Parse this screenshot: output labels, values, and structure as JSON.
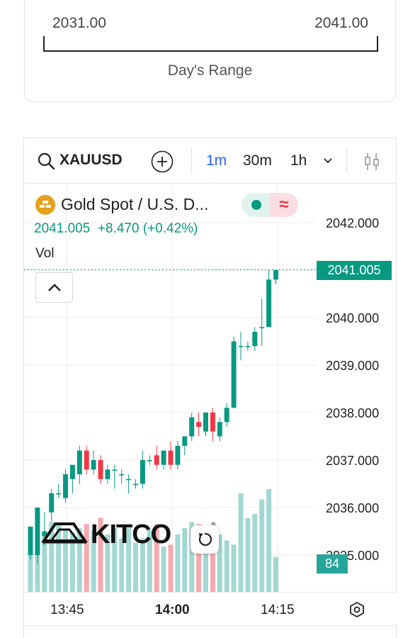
{
  "range": {
    "low": "2031.00",
    "high": "2041.00",
    "label": "Day's Range"
  },
  "toolbar": {
    "symbol": "XAUUSD",
    "intervals": [
      "1m",
      "30m",
      "1h"
    ],
    "active_interval": "1m",
    "icons": [
      "search-icon",
      "add-icon",
      "chevron-down-icon",
      "indicators-icon"
    ]
  },
  "legend": {
    "title": "Gold Spot / U.S. D...",
    "price": "2041.005",
    "change": "+8.470 (+0.42%)",
    "vol_label": "Vol"
  },
  "price_tag": "2041.005",
  "volume_tag": "84",
  "watermark": "KITCO",
  "colors": {
    "up": "#089981",
    "down": "#f23645",
    "vol_up": "#a3d8d2",
    "vol_down": "#f6a9ad",
    "accent": "#2962ff"
  },
  "chart_data": {
    "type": "candlestick",
    "y_ticks": [
      "2042.000",
      "2041.000",
      "2040.000",
      "2039.000",
      "2038.000",
      "2037.000",
      "2036.000",
      "2035.000"
    ],
    "ylim": [
      2034.2,
      2043.5
    ],
    "x_ticks": [
      "13:45",
      "14:00",
      "14:15"
    ],
    "x_ticks_bold": [
      false,
      true,
      false
    ],
    "current_price": 2041.005,
    "candles": [
      {
        "o": 2035.0,
        "h": 2035.3,
        "l": 2034.9,
        "c": 2035.6,
        "v": 58
      },
      {
        "o": 2035.0,
        "h": 2036.0,
        "l": 2034.8,
        "c": 2036.0,
        "v": 76
      },
      {
        "o": 2035.4,
        "h": 2035.9,
        "l": 2035.2,
        "c": 2035.5,
        "v": 58
      },
      {
        "o": 2035.9,
        "h": 2036.4,
        "l": 2035.7,
        "c": 2036.3,
        "v": 68
      },
      {
        "o": 2036.3,
        "h": 2036.5,
        "l": 2036.2,
        "c": 2036.3,
        "v": 66
      },
      {
        "o": 2036.2,
        "h": 2036.8,
        "l": 2036.1,
        "c": 2036.7,
        "v": 60
      },
      {
        "o": 2036.6,
        "h": 2036.9,
        "l": 2036.3,
        "c": 2036.9,
        "v": 58
      },
      {
        "o": 2036.7,
        "h": 2037.3,
        "l": 2036.5,
        "c": 2037.2,
        "v": 62
      },
      {
        "o": 2037.2,
        "h": 2037.3,
        "l": 2036.7,
        "c": 2036.8,
        "v": 66
      },
      {
        "o": 2036.8,
        "h": 2037.2,
        "l": 2036.7,
        "c": 2037.0,
        "v": 60
      },
      {
        "o": 2037.0,
        "h": 2037.1,
        "l": 2036.5,
        "c": 2036.6,
        "v": 72
      },
      {
        "o": 2036.6,
        "h": 2036.9,
        "l": 2036.5,
        "c": 2036.8,
        "v": 56
      },
      {
        "o": 2036.8,
        "h": 2036.9,
        "l": 2036.4,
        "c": 2036.8,
        "v": 62
      },
      {
        "o": 2036.7,
        "h": 2036.8,
        "l": 2036.5,
        "c": 2036.7,
        "v": 52
      },
      {
        "o": 2036.6,
        "h": 2036.7,
        "l": 2036.3,
        "c": 2036.6,
        "v": 62
      },
      {
        "o": 2036.5,
        "h": 2036.6,
        "l": 2036.4,
        "c": 2036.5,
        "v": 48
      },
      {
        "o": 2036.5,
        "h": 2037.2,
        "l": 2036.4,
        "c": 2037.0,
        "v": 52
      },
      {
        "o": 2037.0,
        "h": 2037.1,
        "l": 2036.9,
        "c": 2037.0,
        "v": 60
      },
      {
        "o": 2037.1,
        "h": 2037.3,
        "l": 2036.8,
        "c": 2036.9,
        "v": 66
      },
      {
        "o": 2036.9,
        "h": 2037.2,
        "l": 2036.8,
        "c": 2037.2,
        "v": 44
      },
      {
        "o": 2037.2,
        "h": 2037.4,
        "l": 2036.8,
        "c": 2036.9,
        "v": 46
      },
      {
        "o": 2036.9,
        "h": 2037.4,
        "l": 2036.8,
        "c": 2037.3,
        "v": 56
      },
      {
        "o": 2037.3,
        "h": 2037.5,
        "l": 2037.1,
        "c": 2037.5,
        "v": 62
      },
      {
        "o": 2037.5,
        "h": 2038.0,
        "l": 2037.4,
        "c": 2037.9,
        "v": 68
      },
      {
        "o": 2037.8,
        "h": 2038.0,
        "l": 2037.5,
        "c": 2037.7,
        "v": 66
      },
      {
        "o": 2037.6,
        "h": 2038.0,
        "l": 2037.5,
        "c": 2038.0,
        "v": 60
      },
      {
        "o": 2038.0,
        "h": 2038.1,
        "l": 2037.4,
        "c": 2037.6,
        "v": 64
      },
      {
        "o": 2037.5,
        "h": 2037.9,
        "l": 2037.4,
        "c": 2037.8,
        "v": 56
      },
      {
        "o": 2037.8,
        "h": 2038.2,
        "l": 2037.7,
        "c": 2038.1,
        "v": 50
      },
      {
        "o": 2038.1,
        "h": 2039.6,
        "l": 2038.1,
        "c": 2039.5,
        "v": 46
      },
      {
        "o": 2039.4,
        "h": 2039.7,
        "l": 2039.1,
        "c": 2039.4,
        "v": 96
      },
      {
        "o": 2039.4,
        "h": 2039.5,
        "l": 2039.3,
        "c": 2039.4,
        "v": 72
      },
      {
        "o": 2039.4,
        "h": 2039.8,
        "l": 2039.3,
        "c": 2039.7,
        "v": 76
      },
      {
        "o": 2039.8,
        "h": 2040.4,
        "l": 2039.4,
        "c": 2039.8,
        "v": 90
      },
      {
        "o": 2039.8,
        "h": 2041.0,
        "l": 2039.8,
        "c": 2040.8,
        "v": 100
      },
      {
        "o": 2040.8,
        "h": 2041.0,
        "l": 2040.7,
        "c": 2041.0,
        "v": 34
      }
    ]
  }
}
